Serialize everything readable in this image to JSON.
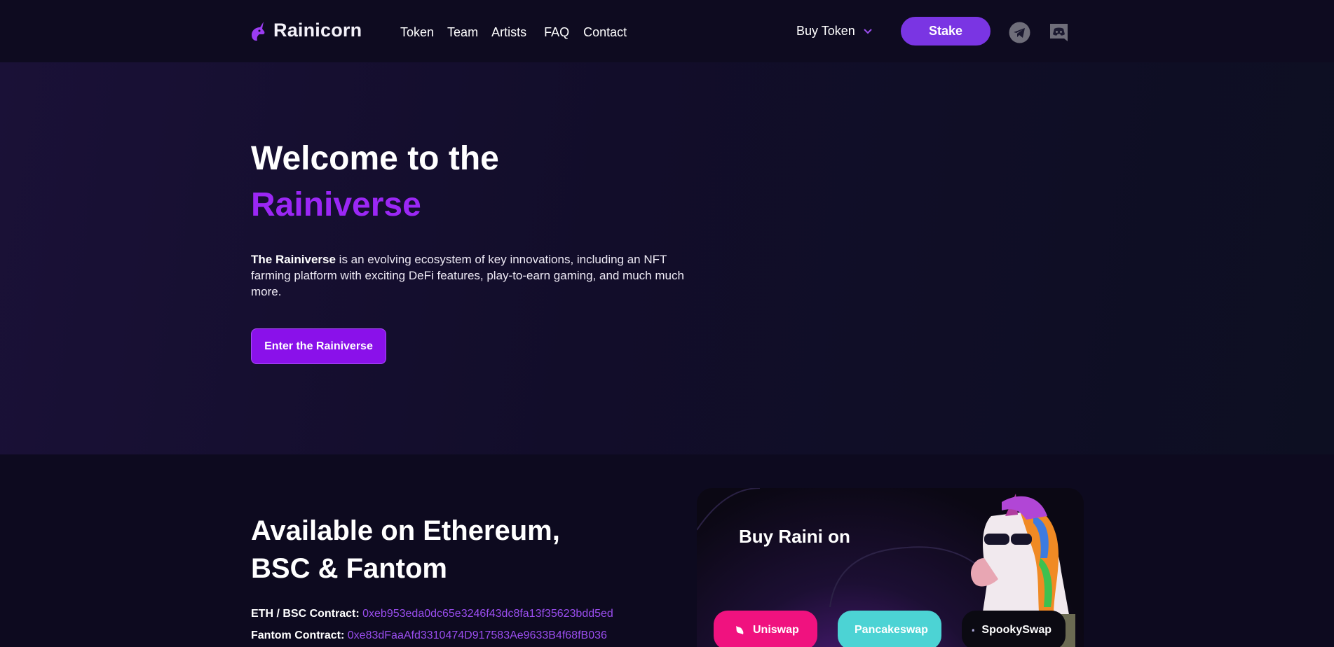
{
  "nav": {
    "brand": "Rainicorn",
    "links": [
      "Token",
      "Team",
      "Artists",
      "FAQ",
      "Contact"
    ],
    "buy_token": "Buy Token",
    "stake": "Stake",
    "social_icons": [
      "telegram-icon",
      "discord-icon"
    ]
  },
  "hero": {
    "title_line1": "Welcome to the",
    "title_line2": "Rainiverse",
    "desc_bold": "The Rainiverse",
    "desc_rest": " is an evolving ecosystem of key innovations, including an NFT farming platform with exciting DeFi features, play-to-earn gaming, and much much more.",
    "cta": "Enter the Rainiverse"
  },
  "available": {
    "title_line1": "Available on Ethereum,",
    "title_line2": "BSC & Fantom",
    "contracts": [
      {
        "label": "ETH / BSC Contract:",
        "address": "0xeb953eda0dc65e3246f43dc8fa13f35623bdd5ed"
      },
      {
        "label": "Fantom Contract:",
        "address": "0xe83dFaaAfd3310474D917583Ae9633B4f68fB036"
      }
    ]
  },
  "buy_card": {
    "title": "Buy Raini on",
    "exchanges": [
      "Uniswap",
      "Pancakeswap",
      "SpookySwap"
    ]
  },
  "colors": {
    "accent": "#9b27f5",
    "stake_bg": "#7a35e3",
    "uniswap": "#f0127f",
    "pancakeswap": "#4cd3d4",
    "spookyswap": "#0b0a12"
  }
}
